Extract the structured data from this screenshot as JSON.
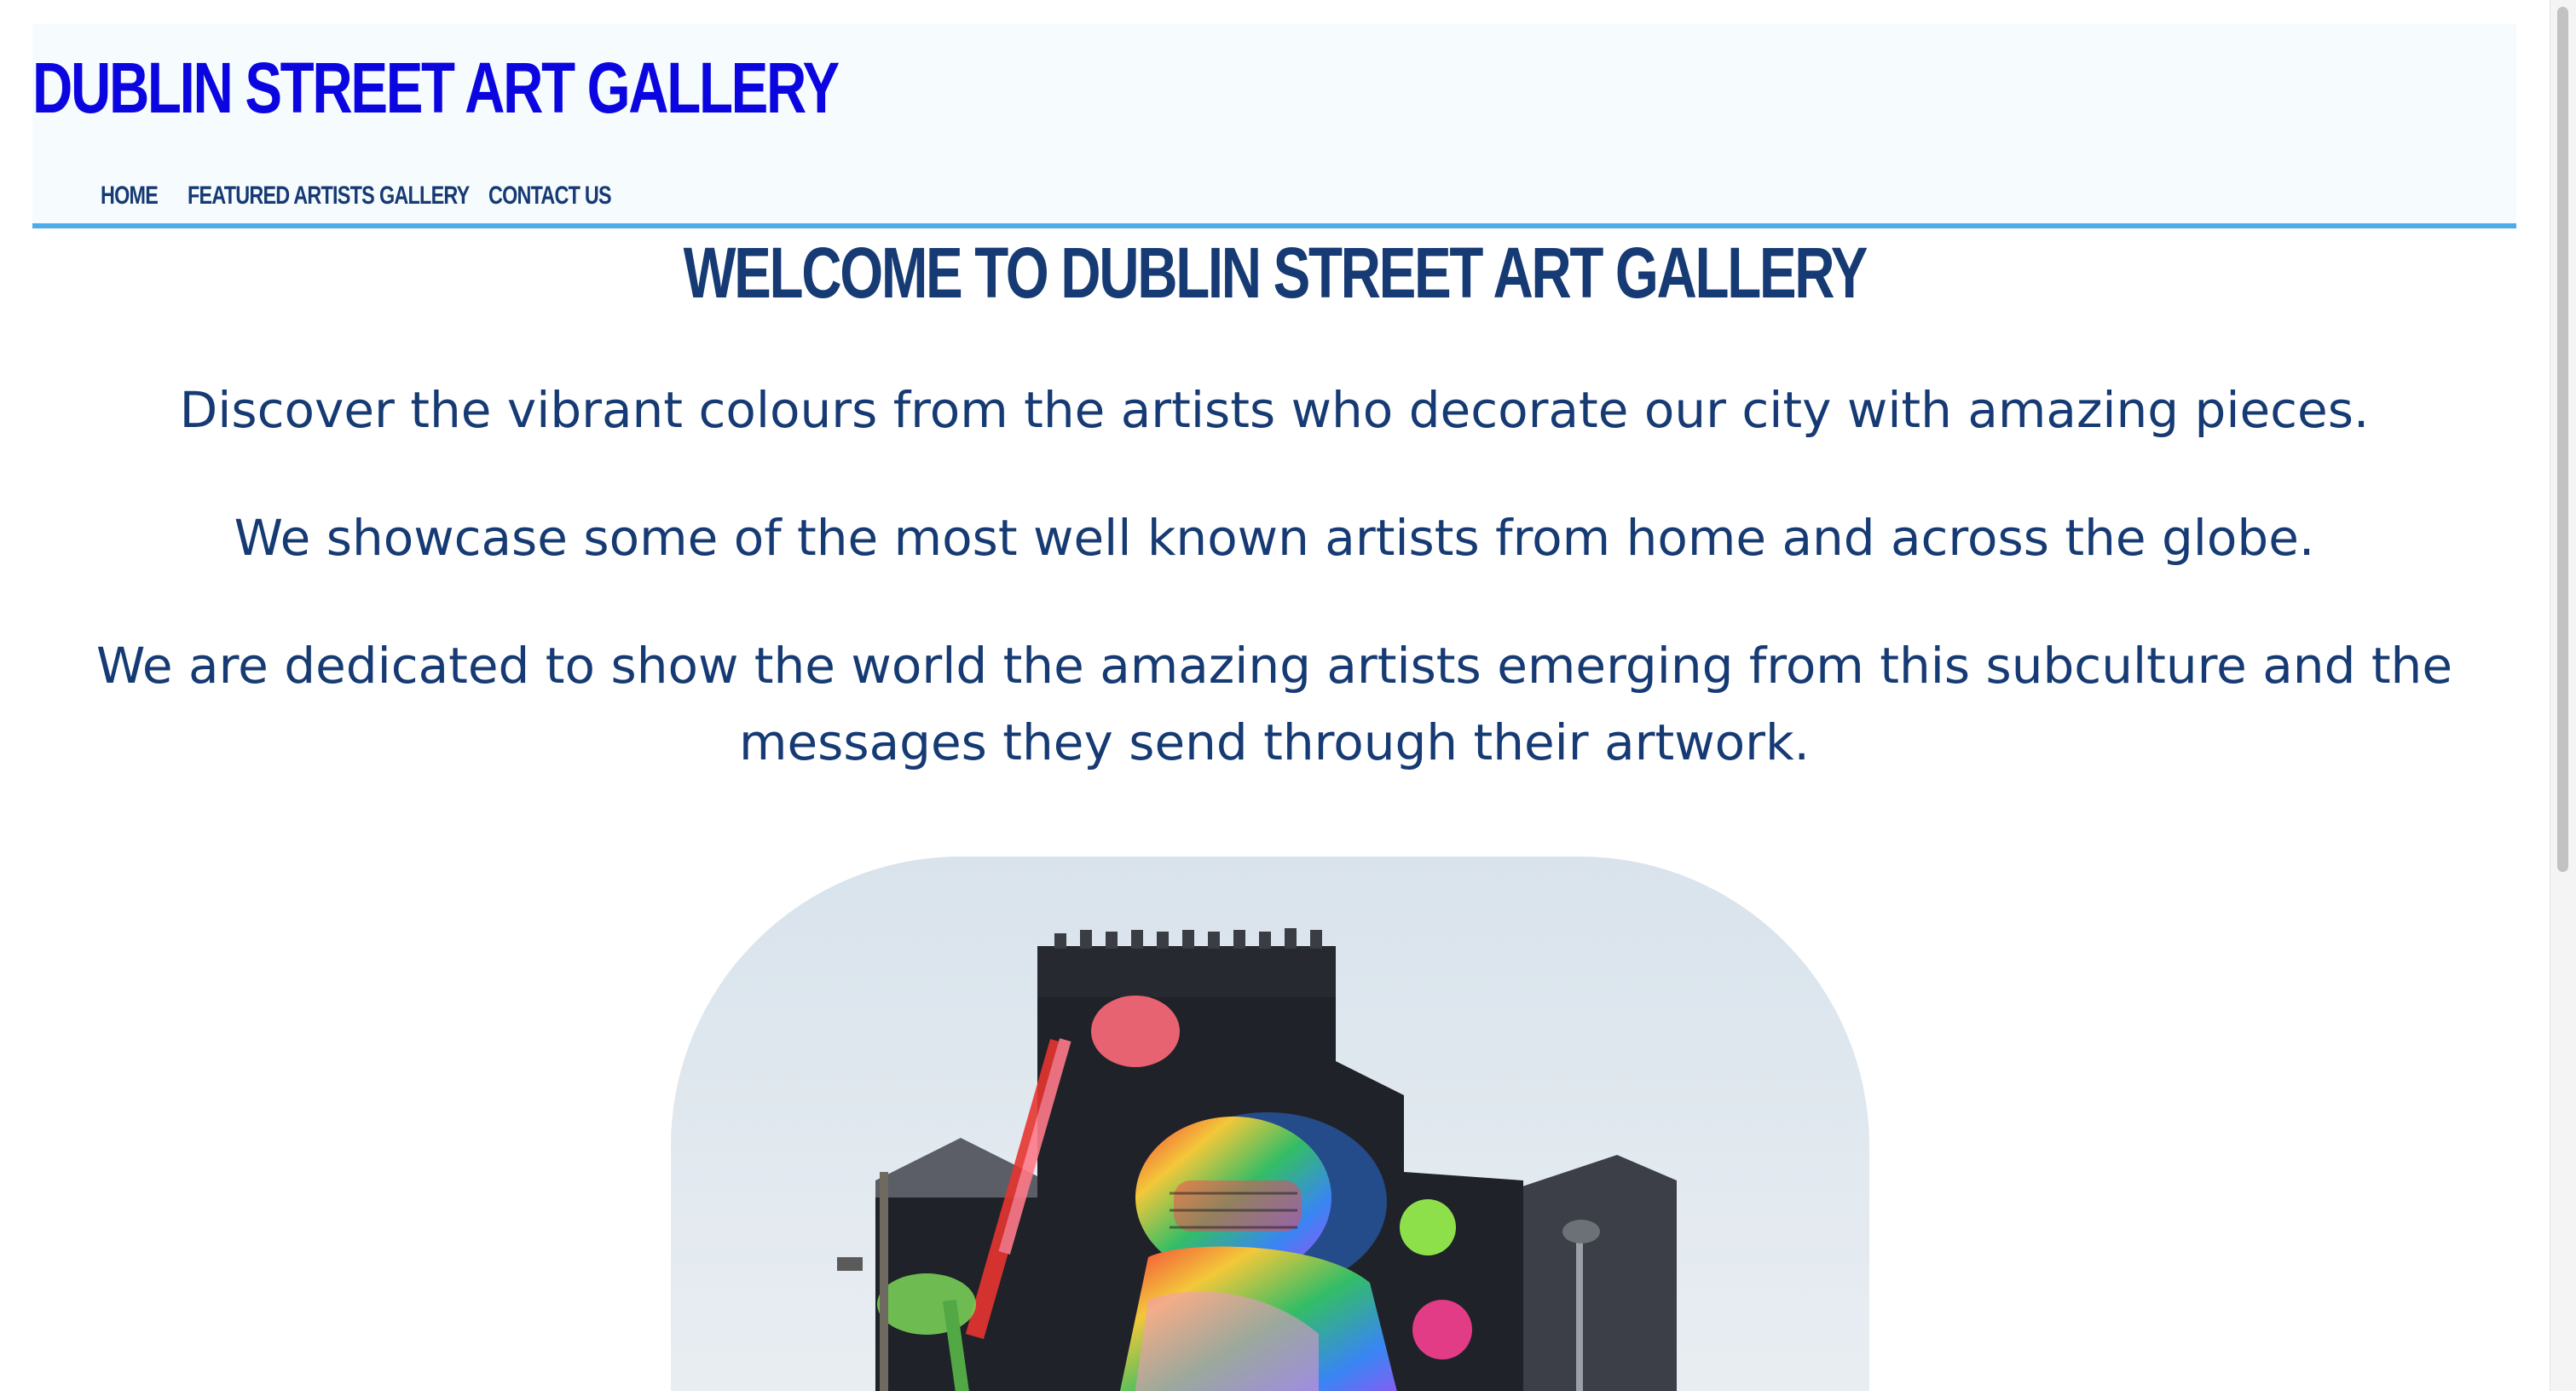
{
  "header": {
    "site_title": "Dublin Street Art Gallery",
    "nav": [
      {
        "label": "Home"
      },
      {
        "label": "Featured Artists"
      },
      {
        "label": "Gallery"
      },
      {
        "label": "Contact Us"
      }
    ]
  },
  "main": {
    "heading": "Welcome to Dublin Street Art Gallery",
    "paragraphs": [
      "Discover the vibrant colours from the artists who decorate our city with amazing pieces.",
      "We showcase some of the most well known artists from home and across the globe.",
      "We are dedicated to show the world the amazing artists emerging from this subculture and the messages they send through their artwork."
    ]
  },
  "colors": {
    "title_blue": "#0b06e0",
    "text_navy": "#163a73",
    "header_border": "#4dabea",
    "header_bg": "#f6fbfd"
  }
}
